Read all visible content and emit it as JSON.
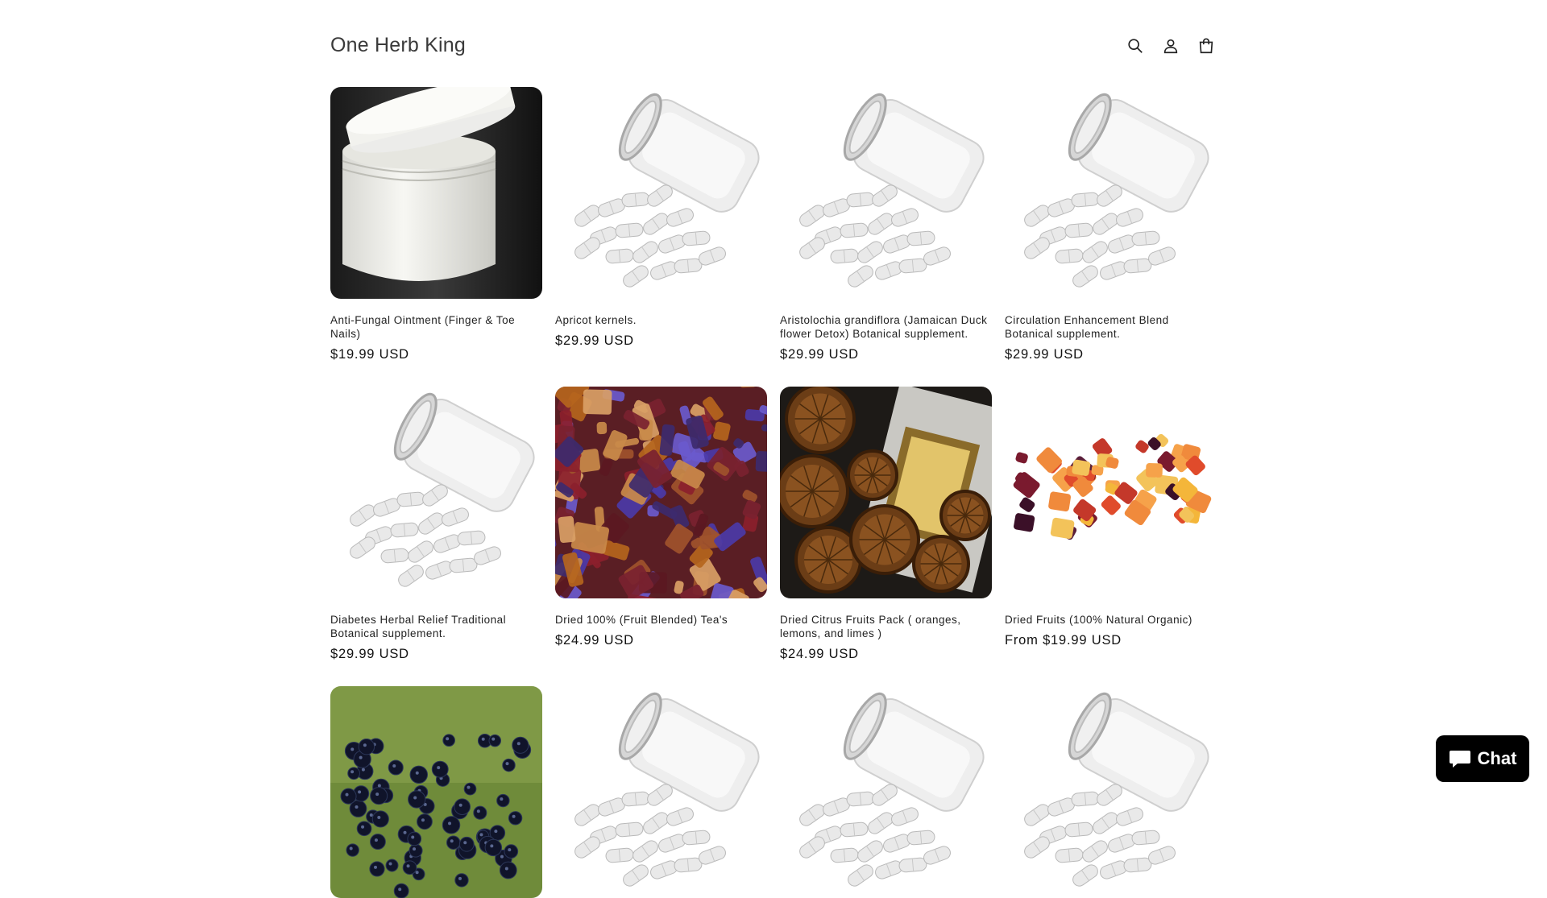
{
  "header": {
    "logo": "One Herb King",
    "icons": [
      "search-icon",
      "account-icon",
      "cart-icon"
    ]
  },
  "products": [
    {
      "title": "Anti-Fungal Ointment (Finger & Toe Nails)",
      "price": "$19.99 USD",
      "image": "white-jar"
    },
    {
      "title": "Apricot kernels.",
      "price": "$29.99 USD",
      "image": "capsule-bottle"
    },
    {
      "title": "Aristolochia grandiflora (Jamaican Duck flower Detox) Botanical supplement.",
      "price": "$29.99 USD",
      "image": "capsule-bottle"
    },
    {
      "title": "Circulation Enhancement Blend Botanical supplement.",
      "price": "$29.99 USD",
      "image": "capsule-bottle"
    },
    {
      "title": "Diabetes Herbal Relief Traditional Botanical supplement.",
      "price": "$29.99 USD",
      "image": "capsule-bottle"
    },
    {
      "title": "Dried 100% (Fruit Blended) Tea's",
      "price": "$24.99 USD",
      "image": "fruit-tea"
    },
    {
      "title": "Dried Citrus Fruits Pack ( oranges, lemons, and limes )",
      "price": "$24.99 USD",
      "image": "dried-citrus"
    },
    {
      "title": "Dried Fruits (100% Natural Organic)",
      "price": "From $19.99 USD",
      "image": "dried-fruits"
    },
    {
      "title": "",
      "price": "",
      "image": "elderberries"
    },
    {
      "title": "",
      "price": "",
      "image": "capsule-bottle"
    },
    {
      "title": "",
      "price": "",
      "image": "capsule-bottle"
    },
    {
      "title": "",
      "price": "",
      "image": "capsule-bottle"
    }
  ],
  "chat": {
    "label": "Chat",
    "icon": "chat-bubble-icon"
  }
}
